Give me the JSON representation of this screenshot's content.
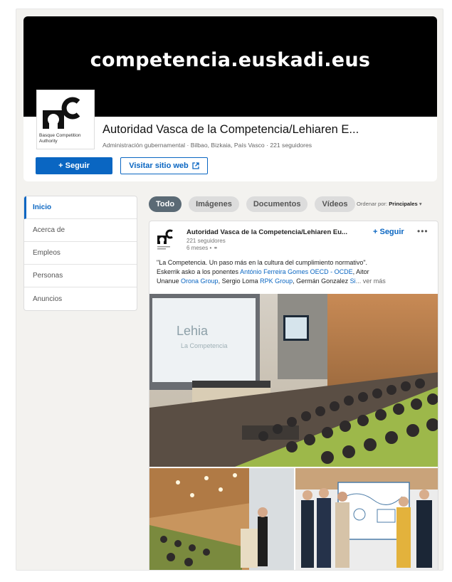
{
  "header": {
    "cover_text": "competencia.euskadi.eus",
    "logo_caption": "Basque Competition Authority",
    "org_name": "Autoridad Vasca de la Competencia/Lehiaren E...",
    "org_subtitle": "Administración gubernamental · Bilbao, Bizkaia, País Vasco · 221 seguidores",
    "follow_label": "+ Seguir",
    "website_label": "Visitar sitio web",
    "website_icon": "external-link-icon"
  },
  "sidebar": {
    "items": [
      {
        "label": "Inicio",
        "active": true
      },
      {
        "label": "Acerca de",
        "active": false
      },
      {
        "label": "Empleos",
        "active": false
      },
      {
        "label": "Personas",
        "active": false
      },
      {
        "label": "Anuncios",
        "active": false
      }
    ]
  },
  "filters": {
    "pills": [
      {
        "label": "Todo",
        "active": true
      },
      {
        "label": "Imágenes",
        "active": false
      },
      {
        "label": "Documentos",
        "active": false
      },
      {
        "label": "Vídeos",
        "active": false
      }
    ],
    "sort_prefix": "Ordenar por:",
    "sort_value": "Principales"
  },
  "post": {
    "author": "Autoridad Vasca de la Competencia/Lehiaren Eu...",
    "followers": "221 seguidores",
    "time": "6 meses •",
    "follow_label": "+ Seguir",
    "more_label": "•••",
    "text_line1": "\"La Competencia. Un paso más en la cultura del cumplimiento normativo\".",
    "text_line2_a": "Eskerrik asko a los ponentes ",
    "text_line2_link": "António Ferreira Gomes OECD - OCDE",
    "text_line2_b": ", Aitor",
    "text_line3_a": "Unanue ",
    "text_line3_link1": "Orona Group",
    "text_line3_b": ", Sergio Loma ",
    "text_line3_link2": "RPK Group",
    "text_line3_c": ", Germán Gonzalez ",
    "text_line3_link3": "Si",
    "see_more": "... ver más",
    "slide_title": "Lehia",
    "slide_subtitle": "La Competencia"
  },
  "colors": {
    "brand": "#0a66c2",
    "cover": "#000000",
    "page_bg": "#f3f2ef"
  }
}
